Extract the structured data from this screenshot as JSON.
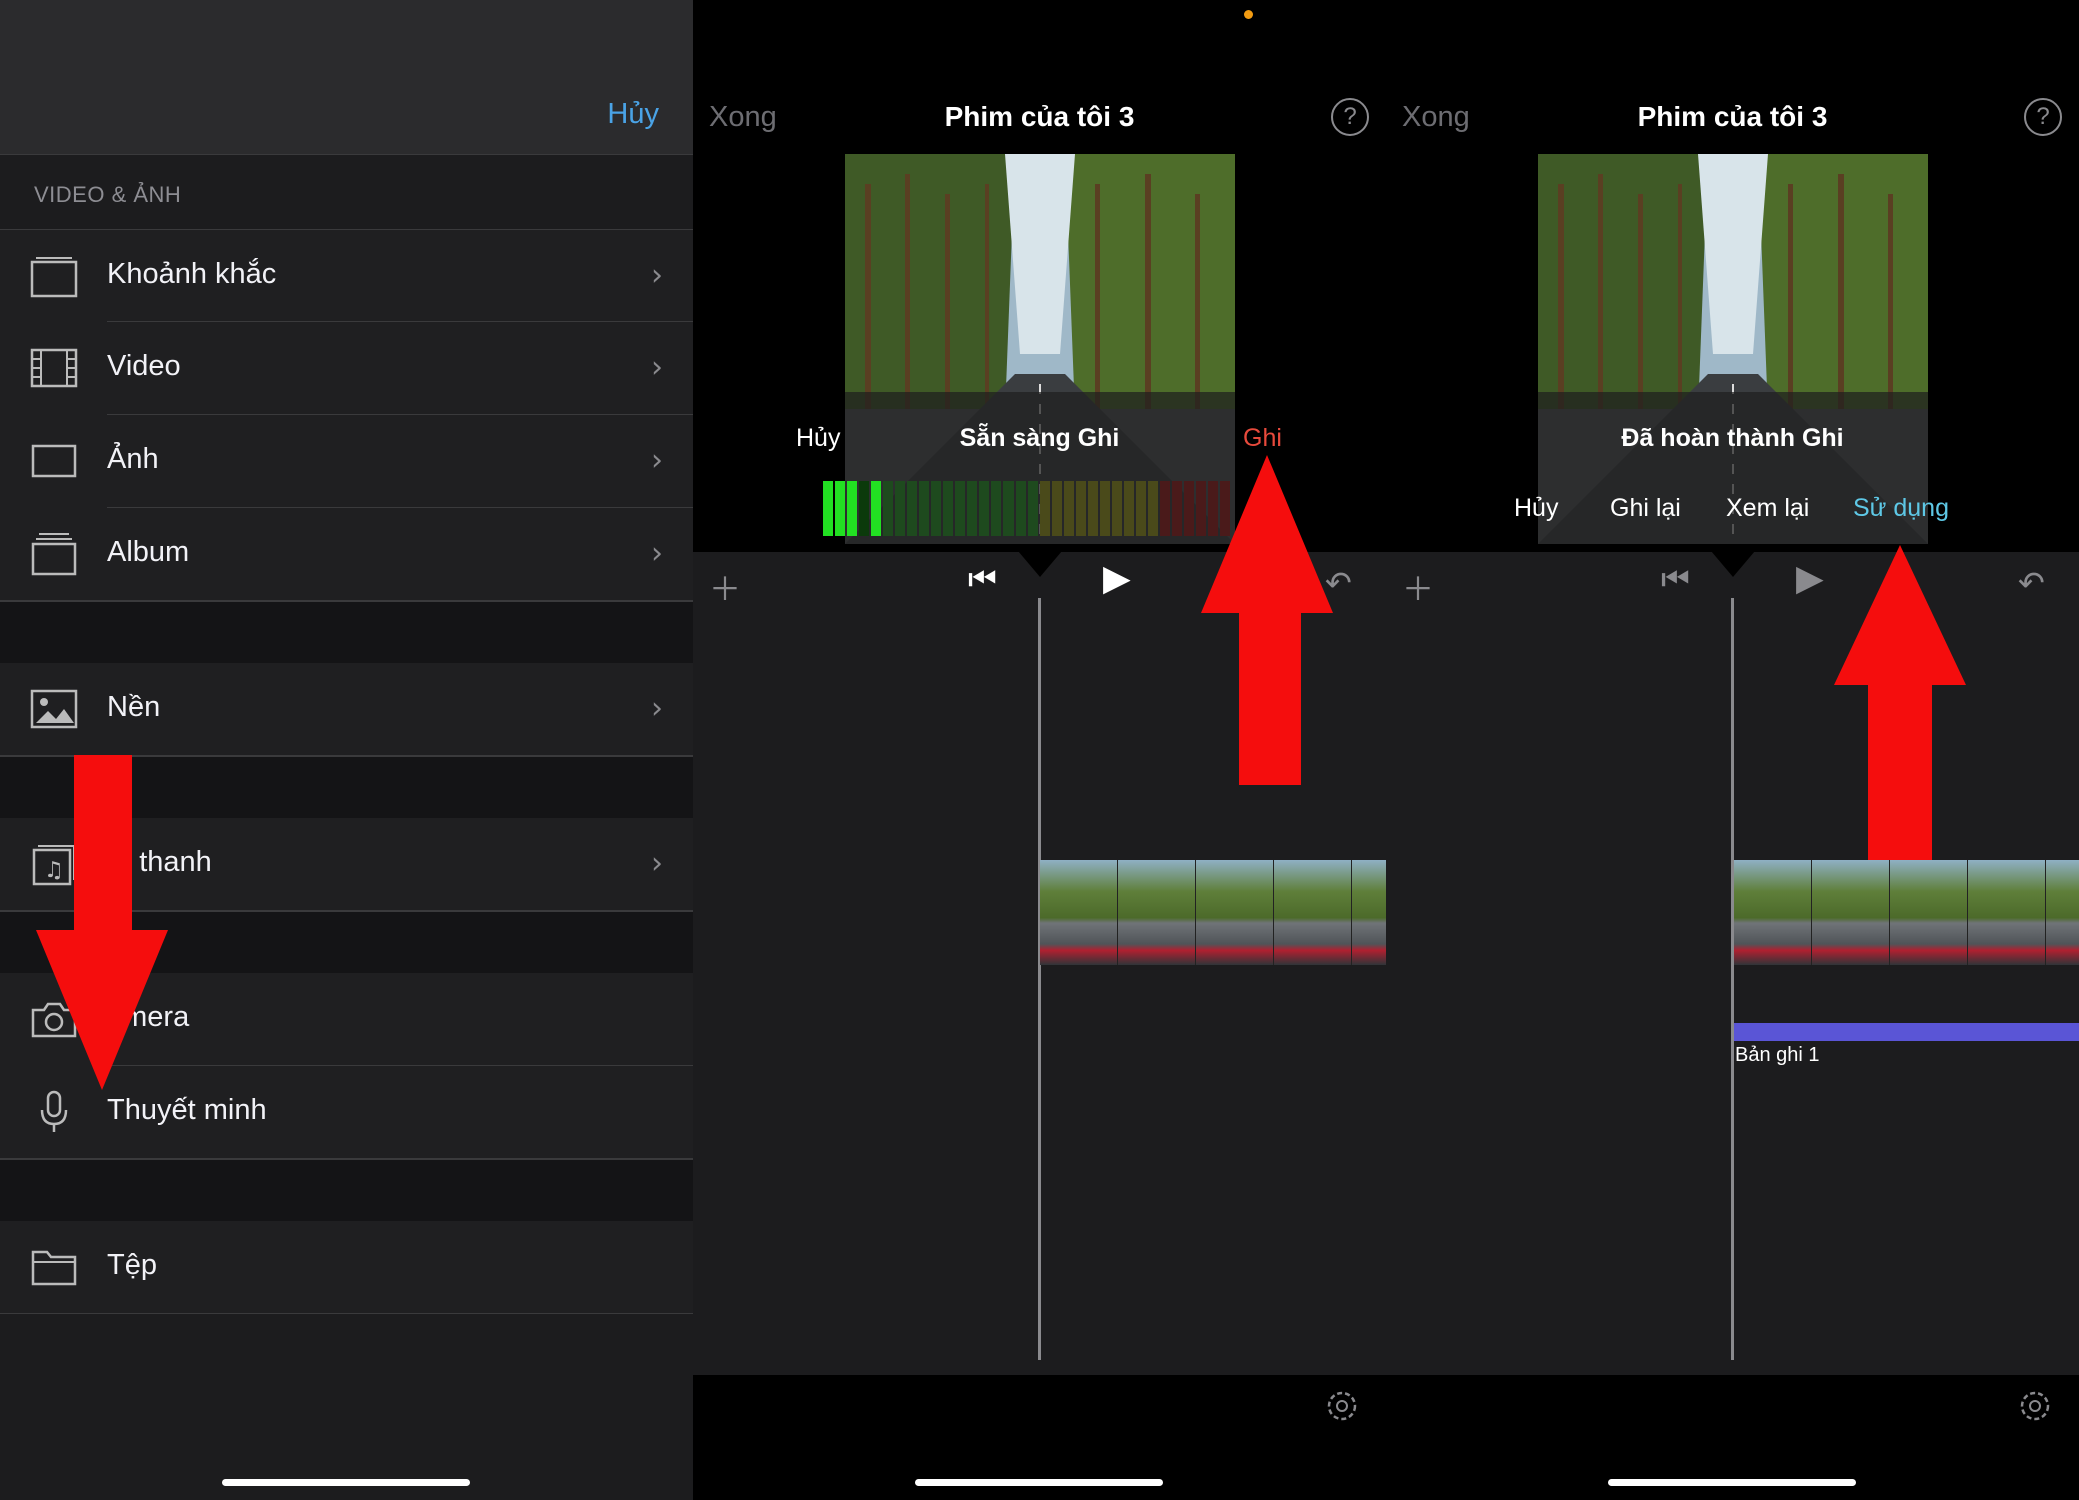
{
  "panel1": {
    "cancel_label": "Hủy",
    "section_header": "VIDEO & ẢNH",
    "items": [
      {
        "label": "Khoảnh khắc",
        "icon": "moments-icon"
      },
      {
        "label": "Video",
        "icon": "film-icon"
      },
      {
        "label": "Ảnh",
        "icon": "photo-icon"
      },
      {
        "label": "Album",
        "icon": "album-icon"
      },
      {
        "label": "Nền",
        "icon": "background-image-icon"
      },
      {
        "label": "m thanh",
        "icon": "music-note-icon"
      },
      {
        "label": "amera",
        "icon": "camera-icon"
      },
      {
        "label": "Thuyết minh",
        "icon": "microphone-icon"
      },
      {
        "label": "Tệp",
        "icon": "folder-icon"
      }
    ]
  },
  "panel2": {
    "done_label": "Xong",
    "title": "Phim của tôi 3",
    "help_symbol": "?",
    "status": "Sẵn sàng Ghi",
    "cancel_label": "Hủy",
    "record_label": "Ghi",
    "record_color": "#e84a3c"
  },
  "panel3": {
    "done_label": "Xong",
    "title": "Phim của tôi 3",
    "help_symbol": "?",
    "status": "Đã hoàn thành Ghi",
    "cancel_label": "Hủy",
    "retake_label": "Ghi lại",
    "review_label": "Xem lại",
    "use_label": "Sử dụng",
    "use_color": "#5ec8e6",
    "audio_clip_label": "Bản ghi 1",
    "audio_clip_color": "#5a55d6"
  },
  "colors": {
    "arrow": "#f50d0d",
    "accent_blue": "#4aa3e6"
  }
}
